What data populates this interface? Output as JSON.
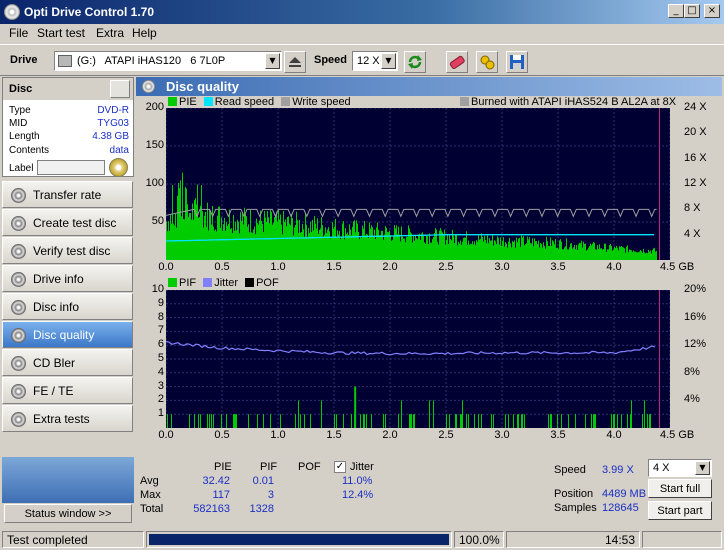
{
  "window": {
    "title": "Opti Drive Control 1.70",
    "minimize": "_",
    "maximize": "□",
    "close": "×"
  },
  "menu": [
    "File",
    "Start test",
    "Extra",
    "Help"
  ],
  "toolbar": {
    "drive_label": "Drive",
    "drive_value": "(G:)   ATAPI iHAS120   6 7L0P",
    "speed_label": "Speed",
    "speed_value": "12 X"
  },
  "disc": {
    "header": "Disc",
    "rows": [
      {
        "k": "Type",
        "v": "DVD-R"
      },
      {
        "k": "MID",
        "v": "TYG03"
      },
      {
        "k": "Length",
        "v": "4.38 GB"
      },
      {
        "k": "Contents",
        "v": "data"
      }
    ],
    "label_key": "Label"
  },
  "nav": [
    {
      "label": "Transfer rate",
      "active": false
    },
    {
      "label": "Create test disc",
      "active": false
    },
    {
      "label": "Verify test disc",
      "active": false
    },
    {
      "label": "Drive info",
      "active": false
    },
    {
      "label": "Disc info",
      "active": false
    },
    {
      "label": "Disc quality",
      "active": true
    },
    {
      "label": "CD Bler",
      "active": false
    },
    {
      "label": "FE / TE",
      "active": false
    },
    {
      "label": "Extra tests",
      "active": false
    }
  ],
  "status_window_btn": "Status window >>",
  "panel_title": "Disc quality",
  "chart_data": [
    {
      "type": "bar",
      "legend": [
        "PIE",
        "Read speed",
        "Write speed"
      ],
      "burned_with": "Burned with ATAPI iHAS524   B AL2A at 8X",
      "colors": {
        "PIE": "#00cc00",
        "Read speed": "#00e5ff",
        "Write speed": "#a0a0a0"
      },
      "x_ticks": [
        "0.0",
        "0.5",
        "1.0",
        "1.5",
        "2.0",
        "2.5",
        "3.0",
        "3.5",
        "4.0",
        "4.5 GB"
      ],
      "y_ticks": [
        "200",
        "150",
        "100",
        "50"
      ],
      "y2_ticks": [
        "24 X",
        "20 X",
        "16 X",
        "12 X",
        "8 X",
        "4 X"
      ],
      "xlim": [
        0,
        4.5
      ],
      "ylim": [
        0,
        200
      ],
      "y2lim": [
        0,
        24
      ],
      "pie_profile": [
        [
          0.0,
          60
        ],
        [
          0.1,
          75
        ],
        [
          0.15,
          78
        ],
        [
          0.4,
          68
        ],
        [
          0.8,
          60
        ],
        [
          1.2,
          55
        ],
        [
          1.6,
          48
        ],
        [
          2.0,
          42
        ],
        [
          2.5,
          36
        ],
        [
          3.0,
          30
        ],
        [
          3.5,
          26
        ],
        [
          4.0,
          18
        ],
        [
          4.38,
          14
        ]
      ],
      "read_speed_x": 3.99,
      "write_speed_x": 8
    },
    {
      "type": "bar",
      "legend": [
        "PIF",
        "Jitter",
        "POF"
      ],
      "colors": {
        "PIF": "#00cc00",
        "Jitter": "#8080ff",
        "POF": "#000000"
      },
      "x_ticks": [
        "0.0",
        "0.5",
        "1.0",
        "1.5",
        "2.0",
        "2.5",
        "3.0",
        "3.5",
        "4.0",
        "4.5 GB"
      ],
      "y_ticks": [
        "10",
        "9",
        "8",
        "7",
        "6",
        "5",
        "4",
        "3",
        "2",
        "1"
      ],
      "y2_ticks": [
        "20%",
        "16%",
        "12%",
        "8%",
        "4%"
      ],
      "xlim": [
        0,
        4.5
      ],
      "ylim": [
        0,
        10
      ],
      "y2lim": [
        0,
        20
      ],
      "jitter_profile": [
        [
          0.0,
          12.4
        ],
        [
          0.5,
          11.6
        ],
        [
          1.0,
          11.2
        ],
        [
          1.5,
          10.9
        ],
        [
          2.0,
          10.8
        ],
        [
          2.5,
          10.8
        ],
        [
          3.0,
          10.9
        ],
        [
          3.5,
          10.9
        ],
        [
          4.0,
          10.9
        ],
        [
          4.38,
          11.8
        ]
      ],
      "pif_max": 3,
      "pif_max_at": 1.68
    }
  ],
  "stats": {
    "headers": [
      "PIE",
      "PIF",
      "POF"
    ],
    "jitter_label": "Jitter",
    "rows": [
      {
        "label": "Avg",
        "pie": "32.42",
        "pif": "0.01",
        "pof": "",
        "jitter": "11.0%"
      },
      {
        "label": "Max",
        "pie": "117",
        "pif": "3",
        "pof": "",
        "jitter": "12.4%"
      },
      {
        "label": "Total",
        "pie": "582163",
        "pif": "1328",
        "pof": "",
        "jitter": ""
      }
    ],
    "speed_label": "Speed",
    "speed_value": "3.99 X",
    "position_label": "Position",
    "position_value": "4489 MB",
    "samples_label": "Samples",
    "samples_value": "128645",
    "speed_select": "4 X",
    "start_full": "Start full",
    "start_part": "Start part"
  },
  "statusbar": {
    "status": "Test completed",
    "percent": "100.0%",
    "progress": 1.0,
    "time": "14:53"
  }
}
